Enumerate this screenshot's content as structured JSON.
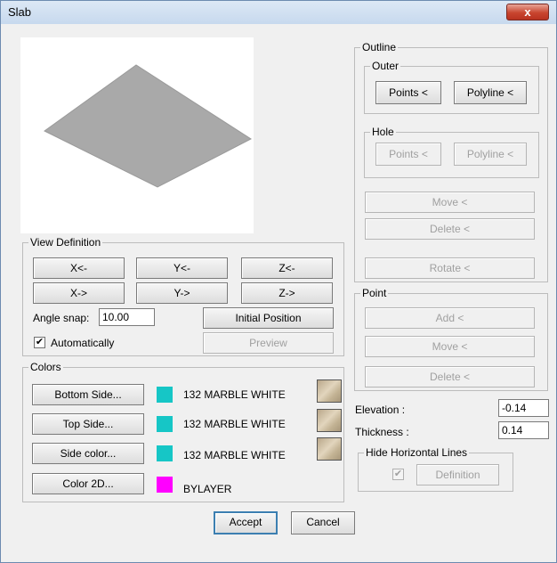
{
  "window": {
    "title": "Slab",
    "close_glyph": "x"
  },
  "view_definition": {
    "label": "View Definition",
    "buttons": [
      "X<-",
      "Y<-",
      "Z<-",
      "X->",
      "Y->",
      "Z->"
    ],
    "angle_snap_label": "Angle snap:",
    "angle_snap_value": "10.00",
    "initial_position": "Initial Position",
    "automatically_label": "Automatically",
    "automatically_checked": true,
    "preview_label": "Preview"
  },
  "colors": {
    "label": "Colors",
    "rows": [
      {
        "button": "Bottom Side...",
        "swatch": "#16c6c6",
        "name": "132 MARBLE WHITE",
        "has_texture": true
      },
      {
        "button": "Top Side...",
        "swatch": "#16c6c6",
        "name": "132 MARBLE WHITE",
        "has_texture": true
      },
      {
        "button": "Side color...",
        "swatch": "#16c6c6",
        "name": "132 MARBLE WHITE",
        "has_texture": true
      },
      {
        "button": "Color 2D...",
        "swatch": "#ff00ff",
        "name": "BYLAYER",
        "has_texture": false
      }
    ]
  },
  "outline": {
    "label": "Outline",
    "outer": {
      "label": "Outer",
      "points": "Points <",
      "polyline": "Polyline <"
    },
    "hole": {
      "label": "Hole",
      "points": "Points <",
      "polyline": "Polyline <"
    },
    "move": "Move <",
    "delete": "Delete <",
    "rotate": "Rotate <"
  },
  "point": {
    "label": "Point",
    "add": "Add <",
    "move": "Move <",
    "delete": "Delete <"
  },
  "elevation": {
    "label": "Elevation :",
    "value": "-0.14"
  },
  "thickness": {
    "label": "Thickness :",
    "value": "0.14"
  },
  "hide_lines": {
    "label": "Hide Horizontal Lines",
    "checked": true,
    "definition": "Definition"
  },
  "footer": {
    "accept": "Accept",
    "cancel": "Cancel"
  }
}
